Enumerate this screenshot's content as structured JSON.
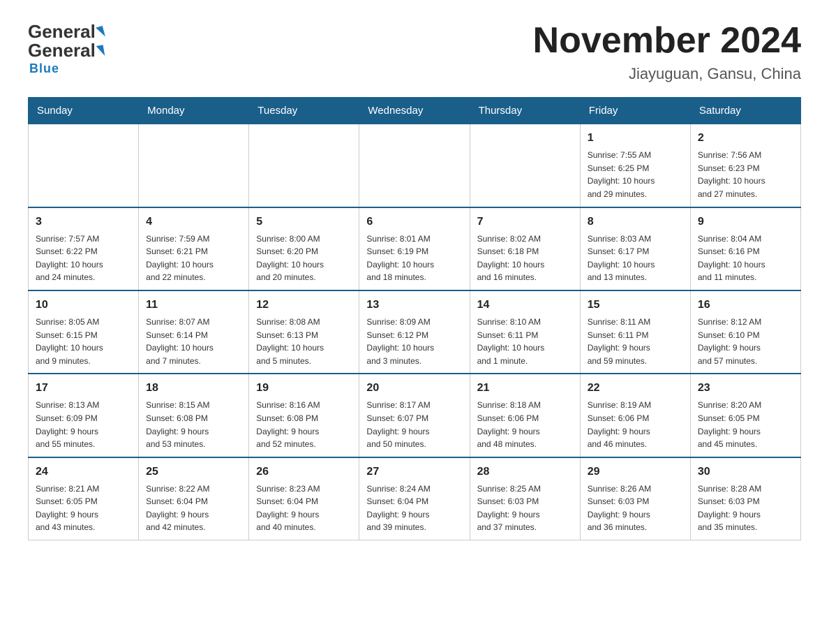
{
  "header": {
    "logo_general": "General",
    "logo_blue": "Blue",
    "month_title": "November 2024",
    "location": "Jiayuguan, Gansu, China"
  },
  "days_of_week": [
    "Sunday",
    "Monday",
    "Tuesday",
    "Wednesday",
    "Thursday",
    "Friday",
    "Saturday"
  ],
  "weeks": [
    {
      "days": [
        {
          "number": "",
          "info": ""
        },
        {
          "number": "",
          "info": ""
        },
        {
          "number": "",
          "info": ""
        },
        {
          "number": "",
          "info": ""
        },
        {
          "number": "",
          "info": ""
        },
        {
          "number": "1",
          "info": "Sunrise: 7:55 AM\nSunset: 6:25 PM\nDaylight: 10 hours\nand 29 minutes."
        },
        {
          "number": "2",
          "info": "Sunrise: 7:56 AM\nSunset: 6:23 PM\nDaylight: 10 hours\nand 27 minutes."
        }
      ]
    },
    {
      "days": [
        {
          "number": "3",
          "info": "Sunrise: 7:57 AM\nSunset: 6:22 PM\nDaylight: 10 hours\nand 24 minutes."
        },
        {
          "number": "4",
          "info": "Sunrise: 7:59 AM\nSunset: 6:21 PM\nDaylight: 10 hours\nand 22 minutes."
        },
        {
          "number": "5",
          "info": "Sunrise: 8:00 AM\nSunset: 6:20 PM\nDaylight: 10 hours\nand 20 minutes."
        },
        {
          "number": "6",
          "info": "Sunrise: 8:01 AM\nSunset: 6:19 PM\nDaylight: 10 hours\nand 18 minutes."
        },
        {
          "number": "7",
          "info": "Sunrise: 8:02 AM\nSunset: 6:18 PM\nDaylight: 10 hours\nand 16 minutes."
        },
        {
          "number": "8",
          "info": "Sunrise: 8:03 AM\nSunset: 6:17 PM\nDaylight: 10 hours\nand 13 minutes."
        },
        {
          "number": "9",
          "info": "Sunrise: 8:04 AM\nSunset: 6:16 PM\nDaylight: 10 hours\nand 11 minutes."
        }
      ]
    },
    {
      "days": [
        {
          "number": "10",
          "info": "Sunrise: 8:05 AM\nSunset: 6:15 PM\nDaylight: 10 hours\nand 9 minutes."
        },
        {
          "number": "11",
          "info": "Sunrise: 8:07 AM\nSunset: 6:14 PM\nDaylight: 10 hours\nand 7 minutes."
        },
        {
          "number": "12",
          "info": "Sunrise: 8:08 AM\nSunset: 6:13 PM\nDaylight: 10 hours\nand 5 minutes."
        },
        {
          "number": "13",
          "info": "Sunrise: 8:09 AM\nSunset: 6:12 PM\nDaylight: 10 hours\nand 3 minutes."
        },
        {
          "number": "14",
          "info": "Sunrise: 8:10 AM\nSunset: 6:11 PM\nDaylight: 10 hours\nand 1 minute."
        },
        {
          "number": "15",
          "info": "Sunrise: 8:11 AM\nSunset: 6:11 PM\nDaylight: 9 hours\nand 59 minutes."
        },
        {
          "number": "16",
          "info": "Sunrise: 8:12 AM\nSunset: 6:10 PM\nDaylight: 9 hours\nand 57 minutes."
        }
      ]
    },
    {
      "days": [
        {
          "number": "17",
          "info": "Sunrise: 8:13 AM\nSunset: 6:09 PM\nDaylight: 9 hours\nand 55 minutes."
        },
        {
          "number": "18",
          "info": "Sunrise: 8:15 AM\nSunset: 6:08 PM\nDaylight: 9 hours\nand 53 minutes."
        },
        {
          "number": "19",
          "info": "Sunrise: 8:16 AM\nSunset: 6:08 PM\nDaylight: 9 hours\nand 52 minutes."
        },
        {
          "number": "20",
          "info": "Sunrise: 8:17 AM\nSunset: 6:07 PM\nDaylight: 9 hours\nand 50 minutes."
        },
        {
          "number": "21",
          "info": "Sunrise: 8:18 AM\nSunset: 6:06 PM\nDaylight: 9 hours\nand 48 minutes."
        },
        {
          "number": "22",
          "info": "Sunrise: 8:19 AM\nSunset: 6:06 PM\nDaylight: 9 hours\nand 46 minutes."
        },
        {
          "number": "23",
          "info": "Sunrise: 8:20 AM\nSunset: 6:05 PM\nDaylight: 9 hours\nand 45 minutes."
        }
      ]
    },
    {
      "days": [
        {
          "number": "24",
          "info": "Sunrise: 8:21 AM\nSunset: 6:05 PM\nDaylight: 9 hours\nand 43 minutes."
        },
        {
          "number": "25",
          "info": "Sunrise: 8:22 AM\nSunset: 6:04 PM\nDaylight: 9 hours\nand 42 minutes."
        },
        {
          "number": "26",
          "info": "Sunrise: 8:23 AM\nSunset: 6:04 PM\nDaylight: 9 hours\nand 40 minutes."
        },
        {
          "number": "27",
          "info": "Sunrise: 8:24 AM\nSunset: 6:04 PM\nDaylight: 9 hours\nand 39 minutes."
        },
        {
          "number": "28",
          "info": "Sunrise: 8:25 AM\nSunset: 6:03 PM\nDaylight: 9 hours\nand 37 minutes."
        },
        {
          "number": "29",
          "info": "Sunrise: 8:26 AM\nSunset: 6:03 PM\nDaylight: 9 hours\nand 36 minutes."
        },
        {
          "number": "30",
          "info": "Sunrise: 8:28 AM\nSunset: 6:03 PM\nDaylight: 9 hours\nand 35 minutes."
        }
      ]
    }
  ]
}
